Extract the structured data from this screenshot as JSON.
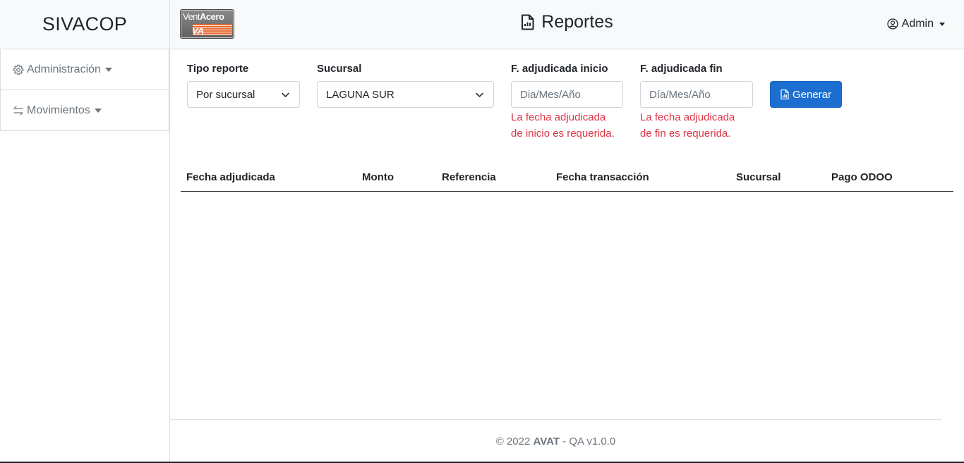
{
  "app": {
    "brand": "SIVACOP"
  },
  "sidebar": {
    "items": [
      {
        "label": "Administración",
        "icon": "gear-icon"
      },
      {
        "label": "Movimientos",
        "icon": "arrows-exchange-icon"
      }
    ]
  },
  "header": {
    "logo_text_a": "Vent",
    "logo_text_b": "Acero",
    "logo_mark": "VA",
    "title": "Reportes",
    "title_icon": "report-file-icon",
    "user": "Admin"
  },
  "form": {
    "tipo_reporte": {
      "label": "Tipo reporte",
      "value": "Por sucursal"
    },
    "sucursal": {
      "label": "Sucursal",
      "value": "LAGUNA SUR"
    },
    "fecha_inicio": {
      "label": "F. adjudicada inicio",
      "placeholder": "Dia/Mes/Año",
      "error_line1": "La fecha adjudicada",
      "error_line2": "de inicio es requerida."
    },
    "fecha_fin": {
      "label": "F. adjudicada fin",
      "placeholder": "Día/Mes/Año",
      "error_line1": "La fecha adjudicada",
      "error_line2": "de fin es requerida."
    },
    "generar_label": "Generar"
  },
  "table": {
    "columns": [
      "Fecha adjudicada",
      "Monto",
      "Referencia",
      "Fecha transacción",
      "Sucursal",
      "Pago ODOO"
    ],
    "rows": []
  },
  "footer": {
    "prefix": "© 2022 ",
    "company": "AVAT",
    "suffix": " - QA v1.0.0"
  },
  "colors": {
    "primary": "#1c6fd1",
    "error": "#dc3545",
    "muted": "#6c757d"
  }
}
